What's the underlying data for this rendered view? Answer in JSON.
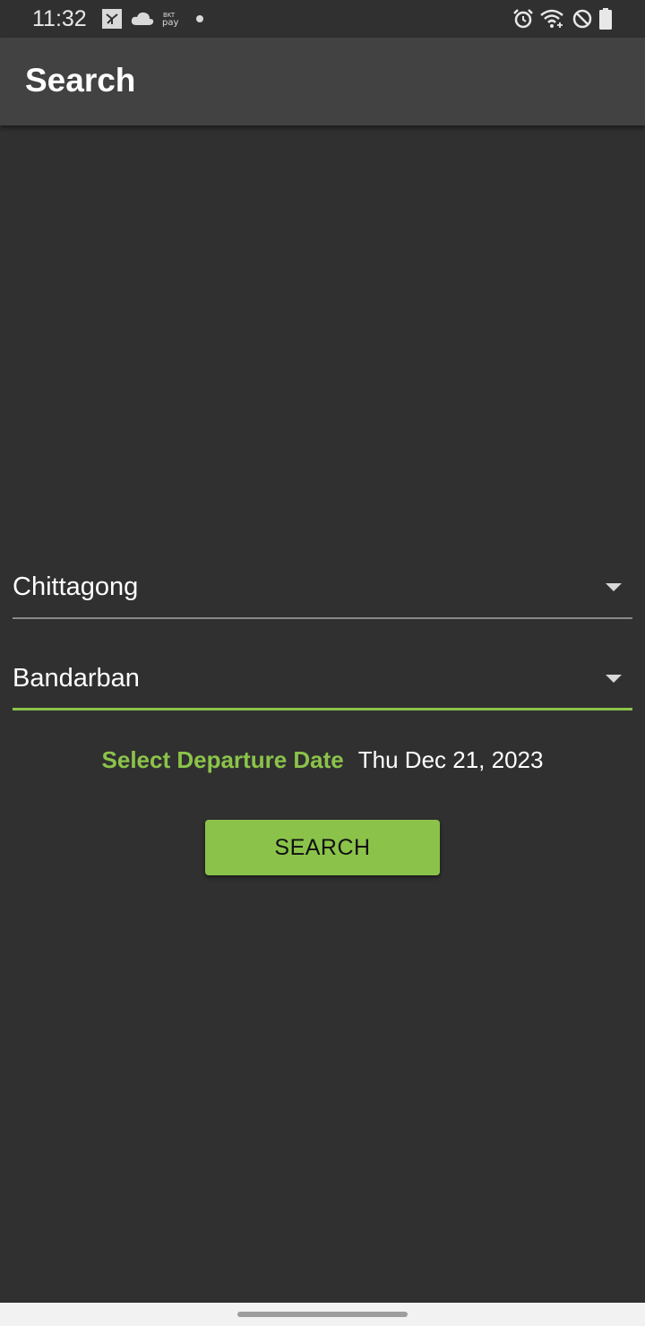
{
  "status_bar": {
    "time": "11:32",
    "left_icons": [
      "image-icon",
      "cloud-icon",
      "pay-icon",
      "notification-dot-icon"
    ],
    "right_icons": [
      "alarm-icon",
      "wifi-icon",
      "do-not-disturb-icon",
      "battery-icon"
    ]
  },
  "app_bar": {
    "title": "Search"
  },
  "form": {
    "from": {
      "value": "Chittagong"
    },
    "to": {
      "value": "Bandarban"
    },
    "departure": {
      "label": "Select Departure Date",
      "value": "Thu Dec 21, 2023"
    },
    "search_button_label": "SEARCH"
  },
  "colors": {
    "background": "#303030",
    "app_bar": "#424242",
    "accent": "#8bc34a",
    "text": "#ffffff",
    "nav_bar": "#f2f2f2"
  }
}
